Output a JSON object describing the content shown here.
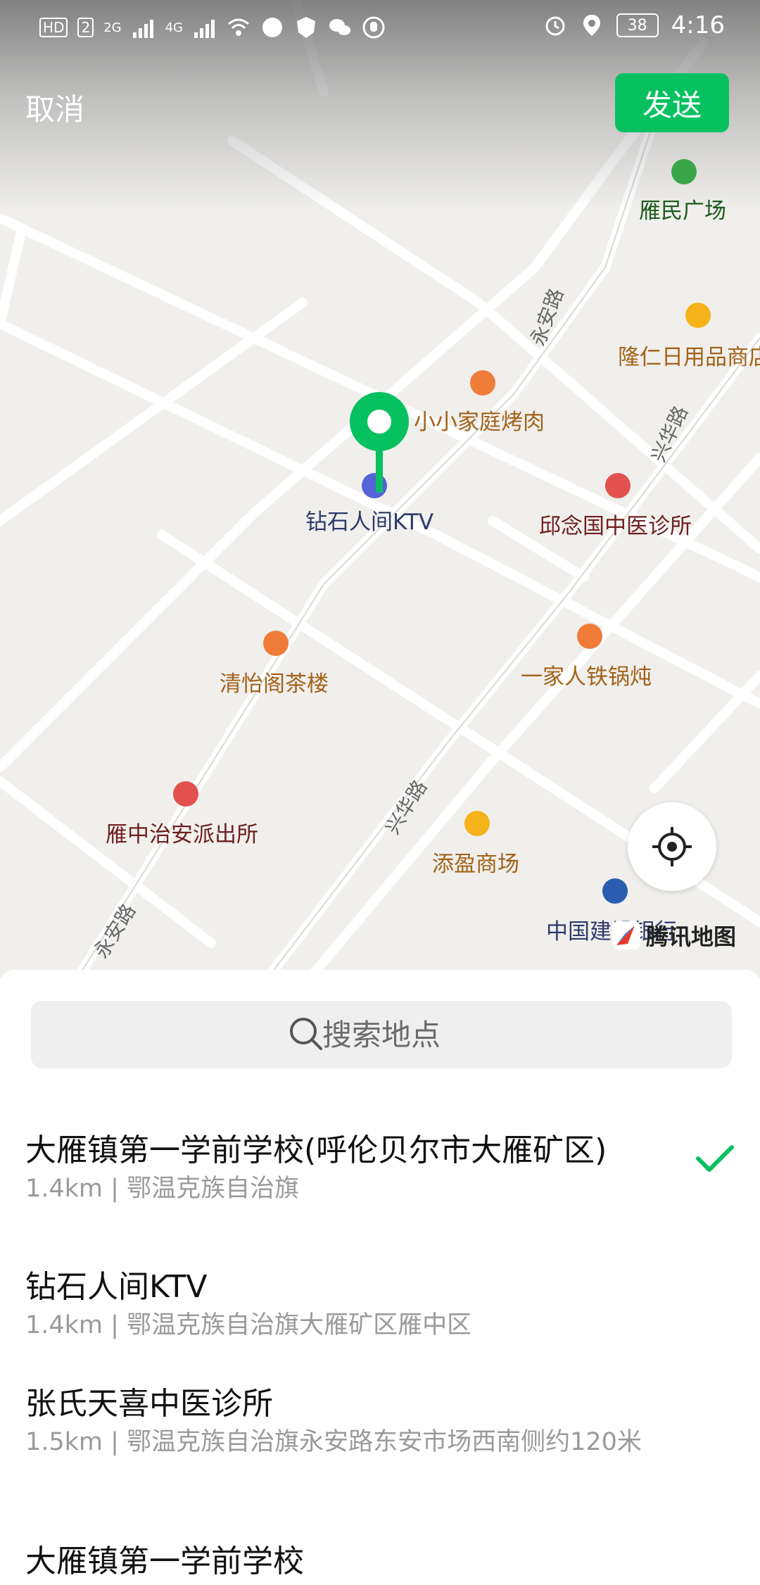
{
  "status_bar": {
    "left": [
      "HD",
      "2",
      "2G",
      "4G"
    ],
    "battery": "38",
    "time": "4:16"
  },
  "header": {
    "cancel_label": "取消",
    "send_label": "发送"
  },
  "map": {
    "pois": [
      {
        "name": "雁民广场",
        "icon": "park-icon"
      },
      {
        "name": "隆仁日用品商店",
        "icon": "shop-icon"
      },
      {
        "name": "小小家庭烤肉",
        "icon": "restaurant-icon"
      },
      {
        "name": "钻石人间KTV",
        "icon": "ktv-icon"
      },
      {
        "name": "邱念国中医诊所",
        "icon": "clinic-icon"
      },
      {
        "name": "清怡阁茶楼",
        "icon": "teahouse-icon"
      },
      {
        "name": "一家人铁锅炖",
        "icon": "restaurant-icon"
      },
      {
        "name": "雁中治安派出所",
        "icon": "police-icon"
      },
      {
        "name": "添盈商场",
        "icon": "mall-icon"
      },
      {
        "name": "中国建设银行",
        "icon": "bank-icon"
      }
    ],
    "roads": [
      "永安路",
      "兴华路",
      "兴华路",
      "永安路"
    ],
    "logo": "腾讯地图",
    "colors": {
      "accent": "#07c160",
      "pin": "#07c160"
    }
  },
  "search": {
    "placeholder": "搜索地点"
  },
  "results": [
    {
      "name": "大雁镇第一学前学校(呼伦贝尔市大雁矿区)",
      "distance": "1.4km",
      "address": "鄂温克族自治旗",
      "selected": true
    },
    {
      "name": "钻石人间KTV",
      "distance": "1.4km",
      "address": "鄂温克族自治旗大雁矿区雁中区",
      "selected": false
    },
    {
      "name": "张氏天喜中医诊所",
      "distance": "1.5km",
      "address": "鄂温克族自治旗永安路东安市场西南侧约120米",
      "selected": false
    },
    {
      "name": "大雁镇第一学前学校",
      "distance": "",
      "address": "",
      "selected": false
    }
  ]
}
